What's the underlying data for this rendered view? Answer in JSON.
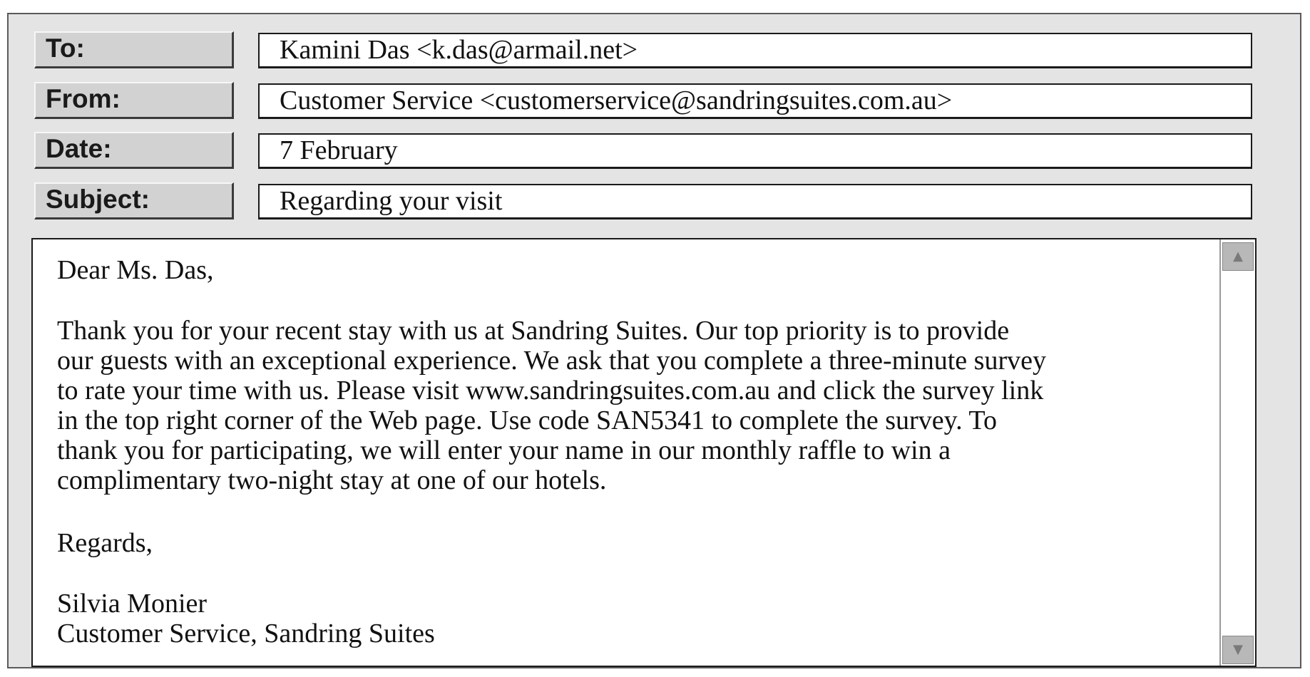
{
  "header": {
    "to": {
      "label": "To:",
      "value": "Kamini Das <k.das@armail.net>"
    },
    "from": {
      "label": "From:",
      "value": "Customer Service <customerservice@sandringsuites.com.au>"
    },
    "date": {
      "label": "Date:",
      "value": "7 February"
    },
    "subject": {
      "label": "Subject:",
      "value": "Regarding your visit"
    }
  },
  "body": {
    "greeting": "Dear Ms. Das,",
    "lines": [
      "Thank you for your recent stay with us at Sandring Suites. Our top priority is to provide",
      "our guests with an exceptional experience. We ask that you complete a three-minute survey",
      "to rate your time with us. Please visit www.sandringsuites.com.au and click the survey link",
      "in the top right corner of the Web page. Use code SAN5341 to complete the survey. To",
      "thank you for participating, we will enter your name in our monthly raffle to win a",
      "complimentary two-night stay at one of our hotels."
    ],
    "closing": "Regards,",
    "signature_name": "Silvia Monier",
    "signature_title": "Customer Service, Sandring Suites"
  },
  "scrollbar": {
    "up_icon": "▲",
    "down_icon": "▼"
  }
}
